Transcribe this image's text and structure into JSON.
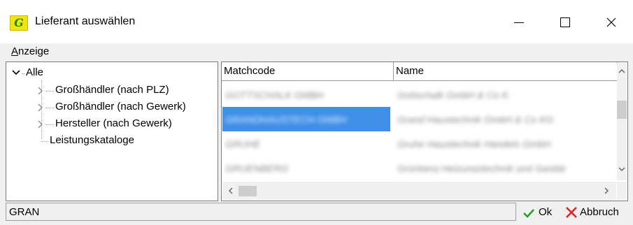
{
  "window": {
    "title": "Lieferant auswählen",
    "icon_glyph": "G",
    "icon": "app-logo-icon",
    "controls": [
      "minimize-icon",
      "maximize-icon",
      "close-icon"
    ]
  },
  "menu": {
    "items": [
      {
        "label": "Anzeige",
        "mnemonic": "A"
      }
    ]
  },
  "tree": {
    "root": {
      "label": "Alle",
      "expanded": true
    },
    "children": [
      {
        "label": "Großhändler (nach PLZ)",
        "expandable": true
      },
      {
        "label": "Großhändler (nach Gewerk)",
        "expandable": true
      },
      {
        "label": "Hersteller (nach Gewerk)",
        "expandable": true
      },
      {
        "label": "Leistungskataloge",
        "expandable": false
      }
    ]
  },
  "grid": {
    "columns": [
      "Matchcode",
      "Name"
    ],
    "rows": [
      {
        "matchcode": "GOTTSCHALK GMBH",
        "name": "Gottschalk GmbH & Co KG",
        "selected": false
      },
      {
        "matchcode": "GRANDHAUSTECH GMBH",
        "name": "Grand Haustechnik GmbH & Co KG",
        "selected": true
      },
      {
        "matchcode": "GRUHE",
        "name": "Gruhe Haustechnik Handels GmbH",
        "selected": false
      },
      {
        "matchcode": "GRUENBERG",
        "name": "Grünberg Heizungstechnik und Sanitär",
        "selected": false
      }
    ],
    "partial_row_visible": true
  },
  "search": {
    "value": "GRAN"
  },
  "buttons": {
    "ok": {
      "label": "Ok",
      "icon": "checkmark-icon",
      "color": "#2a9d2a"
    },
    "cancel": {
      "label": "Abbruch",
      "icon": "x-mark-icon",
      "color": "#e02424"
    }
  },
  "colors": {
    "selection": "#3f8fe8",
    "app_icon_bg": "#f5e30a",
    "app_icon_fg": "#1b8a2a"
  }
}
